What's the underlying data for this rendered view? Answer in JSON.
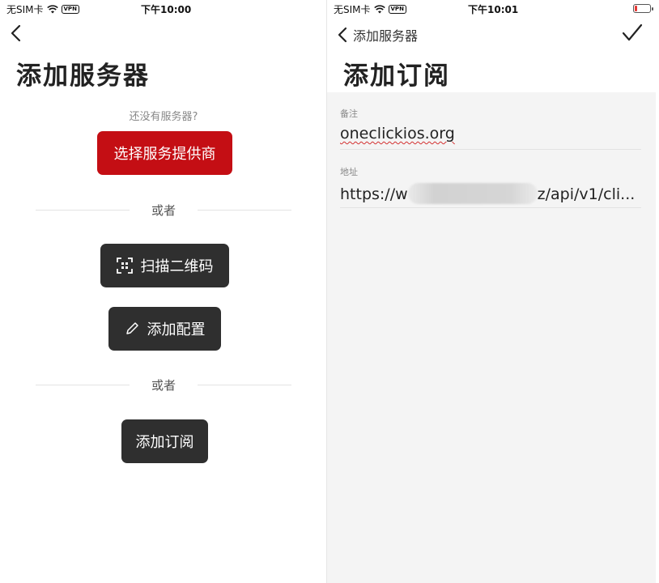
{
  "left": {
    "status": {
      "carrier": "无SIM卡",
      "vpn": "VPN",
      "time": "下午10:00"
    },
    "title": "添加服务器",
    "hint": "还没有服务器?",
    "provider_button": "选择服务提供商",
    "or_1": "或者",
    "scan_button": "扫描二维码",
    "add_config_button": "添加配置",
    "or_2": "或者",
    "add_subscription_button": "添加订阅"
  },
  "right": {
    "status": {
      "carrier": "无SIM卡",
      "vpn": "VPN",
      "time": "下午10:01"
    },
    "back_label": "添加服务器",
    "title": "添加订阅",
    "note_label": "备注",
    "note_value": "oneclickios.org",
    "address_label": "地址",
    "address_prefix": "https://w",
    "address_suffix": "z/api/v1/cli..."
  },
  "colors": {
    "accent": "#c40e14",
    "dark_button": "#2f2f2f",
    "form_bg": "#f4f4f4"
  }
}
